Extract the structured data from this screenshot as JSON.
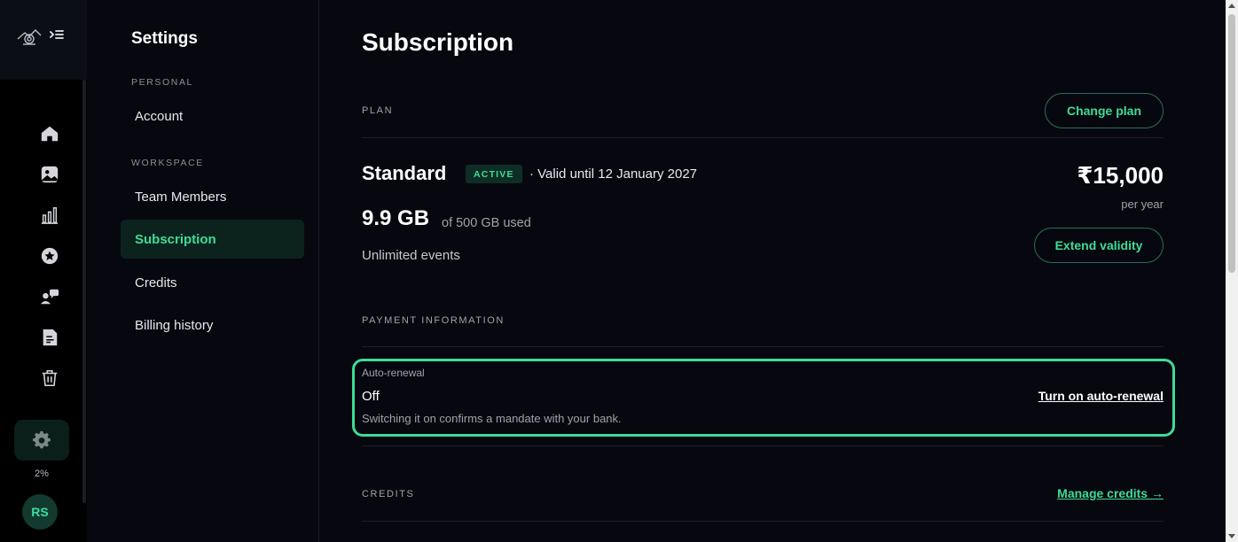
{
  "rail": {
    "icons": [
      "logo-icon",
      "collapse-menu-icon",
      "home-icon",
      "gallery-icon",
      "analytics-icon",
      "favorites-icon",
      "team-chat-icon",
      "document-icon",
      "trash-icon",
      "gear-icon"
    ],
    "usage_percent": "2%",
    "avatar_initials": "RS"
  },
  "settings_nav": {
    "title": "Settings",
    "sections": [
      {
        "label": "PERSONAL",
        "items": [
          "Account"
        ]
      },
      {
        "label": "WORKSPACE",
        "items": [
          "Team Members",
          "Subscription",
          "Credits",
          "Billing history"
        ]
      }
    ],
    "active_item": "Subscription"
  },
  "main": {
    "title": "Subscription",
    "plan": {
      "section_label": "PLAN",
      "change_plan_label": "Change plan",
      "name": "Standard",
      "status": "ACTIVE",
      "validity": "· Valid until 12 January 2027",
      "storage_used": "9.9 GB",
      "storage_total": "of 500 GB used",
      "events": "Unlimited events",
      "price": "₹15,000",
      "period": "per year",
      "extend_label": "Extend validity"
    },
    "payment": {
      "section_label": "PAYMENT INFORMATION",
      "auto_renewal_label": "Auto-renewal",
      "auto_renewal_value": "Off",
      "auto_renewal_note": "Switching it on confirms a mandate with your bank.",
      "turn_on_label": "Turn on auto-renewal"
    },
    "credits": {
      "section_label": "CREDITS",
      "manage_label": "Manage credits →"
    }
  },
  "colors": {
    "accent": "#3ddc97",
    "background": "#07080f",
    "rail_background": "#000000",
    "active_nav_background": "#0c231d"
  }
}
